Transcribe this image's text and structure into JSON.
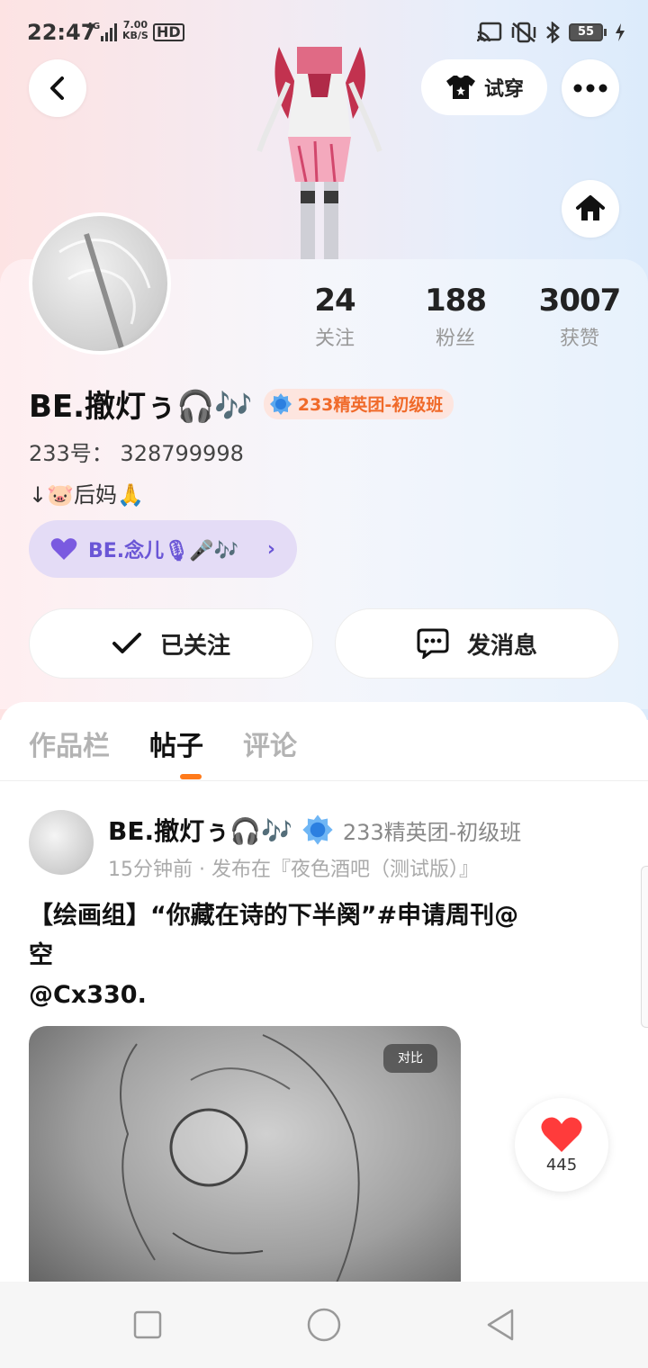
{
  "status_bar": {
    "time": "22:47",
    "network": "4G",
    "speed_value": "7.00",
    "speed_unit": "KB/S",
    "hd": "HD",
    "battery": "55"
  },
  "header": {
    "tryon_label": "试穿"
  },
  "profile": {
    "stats": [
      {
        "value": "24",
        "label": "关注"
      },
      {
        "value": "188",
        "label": "粉丝"
      },
      {
        "value": "3007",
        "label": "获赞"
      }
    ],
    "username": "BE.撤灯ぅ🎧🎶",
    "badge": "233精英团-初级班",
    "id_text": "233号： 328799998",
    "bio": "↓🐷后妈🙏",
    "fan_pill": "BE.念儿🎙🎤🎶",
    "followed_label": "已关注",
    "message_label": "发消息"
  },
  "tabs": [
    {
      "label": "作品栏"
    },
    {
      "label": "帖子"
    },
    {
      "label": "评论"
    }
  ],
  "post": {
    "author": "BE.撤灯ぅ🎧🎶",
    "badge": "233精英团-初级班",
    "meta": "15分钟前 · 发布在『夜色酒吧（测试版）』",
    "text_line1": "【绘画组】“你藏在诗的下半阕”#申请周刊@",
    "text_line2": "空",
    "text_line3": "@Cx330.",
    "compare_label": "对比",
    "likes": "445"
  },
  "colors": {
    "accent_orange": "#ff7a1a",
    "badge_orange": "#f06a2a",
    "fan_purple": "#6a56d6",
    "like_red": "#ff3b3b"
  }
}
